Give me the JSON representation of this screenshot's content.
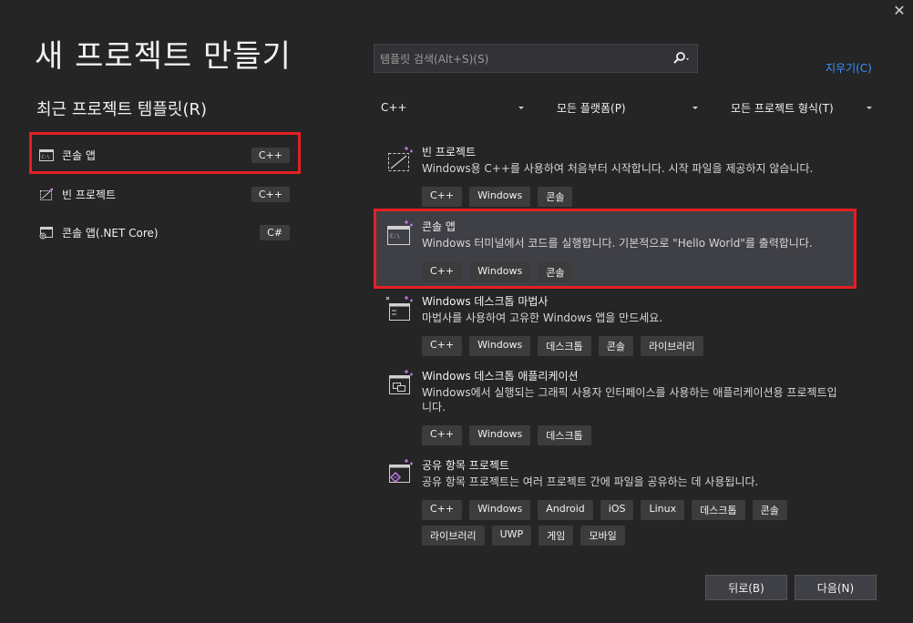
{
  "window": {
    "close_glyph": "✕"
  },
  "page_title": "새 프로젝트 만들기",
  "recent": {
    "heading": "최근 프로젝트 템플릿(R)",
    "items": [
      {
        "label": "콘솔 앱",
        "lang": "C++",
        "icon": "console-app-icon"
      },
      {
        "label": "빈 프로젝트",
        "lang": "C++",
        "icon": "empty-project-icon"
      },
      {
        "label": "콘솔 앱(.NET Core)",
        "lang": "C#",
        "icon": "dotnet-console-icon"
      }
    ]
  },
  "search": {
    "placeholder": "템플릿 검색(Alt+S)(S)",
    "value": ""
  },
  "clear_label": "지우기(C)",
  "filters": {
    "language": "C++",
    "platform": "모든 플랫폼(P)",
    "project_type": "모든 프로젝트 형식(T)"
  },
  "templates": [
    {
      "name": "빈 프로젝트",
      "description": "Windows용 C++를 사용하여 처음부터 시작합니다. 시작 파일을 제공하지 않습니다.",
      "tags": [
        "C++",
        "Windows",
        "콘솔"
      ],
      "icon": "empty-project-icon"
    },
    {
      "name": "콘솔 앱",
      "description": "Windows 터미널에서 코드를 실행합니다. 기본적으로 \"Hello World\"를 출력합니다.",
      "tags": [
        "C++",
        "Windows",
        "콘솔"
      ],
      "icon": "console-app-icon"
    },
    {
      "name": "Windows 데스크톱 마법사",
      "description": "마법사를 사용하여 고유한 Windows 앱을 만드세요.",
      "tags": [
        "C++",
        "Windows",
        "데스크톱",
        "콘솔",
        "라이브러리"
      ],
      "icon": "desktop-wizard-icon"
    },
    {
      "name": "Windows 데스크톱 애플리케이션",
      "description": "Windows에서 실행되는 그래픽 사용자 인터페이스를 사용하는 애플리케이션용 프로젝트입니다.",
      "tags": [
        "C++",
        "Windows",
        "데스크톱"
      ],
      "icon": "desktop-app-icon"
    },
    {
      "name": "공유 항목 프로젝트",
      "description": "공유 항목 프로젝트는 여러 프로젝트 간에 파일을 공유하는 데 사용됩니다.",
      "tags": [
        "C++",
        "Windows",
        "Android",
        "iOS",
        "Linux",
        "데스크톱",
        "콘솔",
        "라이브러리",
        "UWP",
        "게임",
        "모바일"
      ],
      "icon": "shared-items-icon"
    }
  ],
  "buttons": {
    "back": "뒤로(B)",
    "next": "다음(N)"
  },
  "colors": {
    "accent_link": "#3794ff",
    "highlight": "#e51f23",
    "background": "#252526",
    "selected_item": "#3f3f46"
  }
}
